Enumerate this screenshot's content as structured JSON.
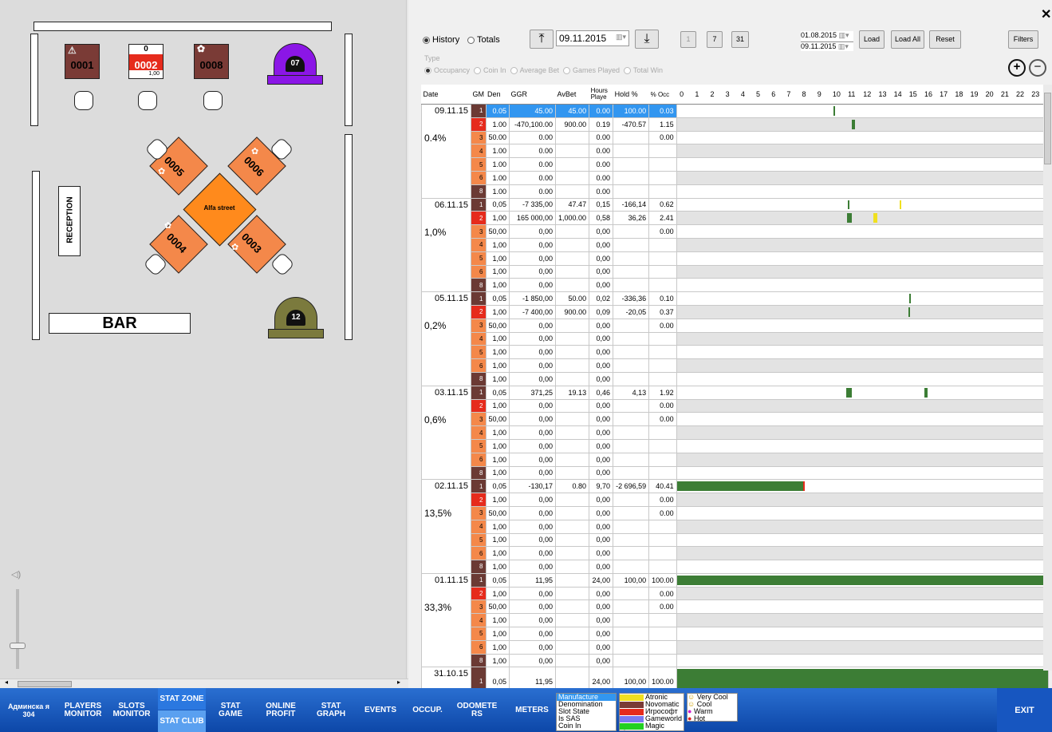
{
  "floor": {
    "machines": [
      {
        "id": "0001",
        "color": "#7a3b36",
        "warn": true
      },
      {
        "id": "0002",
        "color": "#e62b1c",
        "top": "0",
        "bottom": "1,00"
      },
      {
        "id": "0008",
        "color": "#7a3b36",
        "gear": true
      }
    ],
    "domes": [
      {
        "label": "07",
        "color": "#8b16e6"
      },
      {
        "label": "12",
        "color": "#7b7a3d"
      }
    ],
    "diamond_machines": [
      "0005",
      "0006",
      "0004",
      "0003"
    ],
    "center_label": "Alfa street",
    "reception": "RECEPTION",
    "bar": "BAR"
  },
  "controls": {
    "history": "History",
    "totals": "Totals",
    "date": "09.11.2015",
    "day_buttons": [
      "1",
      "7",
      "31"
    ],
    "range_from": "01.08.2015",
    "range_to": "09.11.2015",
    "load": "Load",
    "load_all": "Load All",
    "reset": "Reset",
    "filters": "Filters",
    "type_label": "Type",
    "type_options": [
      "Occupancy",
      "Coin In",
      "Average Bet",
      "Games Played",
      "Total Win"
    ]
  },
  "grid": {
    "headers": [
      "Date",
      "GM",
      "Den",
      "GGR",
      "AvBet",
      "Hours Playe",
      "Hold %",
      "% Occ"
    ],
    "hours": [
      "0",
      "1",
      "2",
      "3",
      "4",
      "5",
      "6",
      "7",
      "8",
      "9",
      "10",
      "11",
      "12",
      "13",
      "14",
      "15",
      "16",
      "17",
      "18",
      "19",
      "20",
      "21",
      "22",
      "23"
    ],
    "groups": [
      {
        "date": "09.11.15",
        "pct": "0.4%",
        "rows": [
          [
            "1",
            "0.05",
            "45.00",
            "45.00",
            "0.00",
            "100.00",
            "0.03"
          ],
          [
            "2",
            "1.00",
            "-470,100.00",
            "900.00",
            "0.19",
            "-470.57",
            "1.15"
          ],
          [
            "3",
            "50.00",
            "0.00",
            "",
            "0.00",
            "",
            "0.00"
          ],
          [
            "4",
            "1.00",
            "0.00",
            "",
            "0.00",
            "",
            ""
          ],
          [
            "5",
            "1.00",
            "0.00",
            "",
            "0.00",
            "",
            ""
          ],
          [
            "6",
            "1.00",
            "0.00",
            "",
            "0.00",
            "",
            ""
          ],
          [
            "8",
            "1.00",
            "0.00",
            "",
            "0.00",
            "",
            ""
          ]
        ]
      },
      {
        "date": "06.11.15",
        "pct": "1,0%",
        "rows": [
          [
            "1",
            "0,05",
            "-7 335,00",
            "47.47",
            "0,15",
            "-166,14",
            "0.62"
          ],
          [
            "2",
            "1,00",
            "165 000,00",
            "1,000.00",
            "0,58",
            "36,26",
            "2.41"
          ],
          [
            "3",
            "50,00",
            "0,00",
            "",
            "0,00",
            "",
            "0.00"
          ],
          [
            "4",
            "1,00",
            "0,00",
            "",
            "0,00",
            "",
            ""
          ],
          [
            "5",
            "1,00",
            "0,00",
            "",
            "0,00",
            "",
            ""
          ],
          [
            "6",
            "1,00",
            "0,00",
            "",
            "0,00",
            "",
            ""
          ],
          [
            "8",
            "1,00",
            "0,00",
            "",
            "0,00",
            "",
            ""
          ]
        ]
      },
      {
        "date": "05.11.15",
        "pct": "0,2%",
        "rows": [
          [
            "1",
            "0,05",
            "-1 850,00",
            "50.00",
            "0,02",
            "-336,36",
            "0.10"
          ],
          [
            "2",
            "1,00",
            "-7 400,00",
            "900.00",
            "0,09",
            "-20,05",
            "0.37"
          ],
          [
            "3",
            "50,00",
            "0,00",
            "",
            "0,00",
            "",
            "0.00"
          ],
          [
            "4",
            "1,00",
            "0,00",
            "",
            "0,00",
            "",
            ""
          ],
          [
            "5",
            "1,00",
            "0,00",
            "",
            "0,00",
            "",
            ""
          ],
          [
            "6",
            "1,00",
            "0,00",
            "",
            "0,00",
            "",
            ""
          ],
          [
            "8",
            "1,00",
            "0,00",
            "",
            "0,00",
            "",
            ""
          ]
        ]
      },
      {
        "date": "03.11.15",
        "pct": "0,6%",
        "rows": [
          [
            "1",
            "0,05",
            "371,25",
            "19.13",
            "0,46",
            "4,13",
            "1.92"
          ],
          [
            "2",
            "1,00",
            "0,00",
            "",
            "0,00",
            "",
            "0.00"
          ],
          [
            "3",
            "50,00",
            "0,00",
            "",
            "0,00",
            "",
            "0.00"
          ],
          [
            "4",
            "1,00",
            "0,00",
            "",
            "0,00",
            "",
            ""
          ],
          [
            "5",
            "1,00",
            "0,00",
            "",
            "0,00",
            "",
            ""
          ],
          [
            "6",
            "1,00",
            "0,00",
            "",
            "0,00",
            "",
            ""
          ],
          [
            "8",
            "1,00",
            "0,00",
            "",
            "0,00",
            "",
            ""
          ]
        ]
      },
      {
        "date": "02.11.15",
        "pct": "13,5%",
        "rows": [
          [
            "1",
            "0,05",
            "-130,17",
            "0.80",
            "9,70",
            "-2 696,59",
            "40.41"
          ],
          [
            "2",
            "1,00",
            "0,00",
            "",
            "0,00",
            "",
            "0.00"
          ],
          [
            "3",
            "50,00",
            "0,00",
            "",
            "0,00",
            "",
            "0.00"
          ],
          [
            "4",
            "1,00",
            "0,00",
            "",
            "0,00",
            "",
            ""
          ],
          [
            "5",
            "1,00",
            "0,00",
            "",
            "0,00",
            "",
            ""
          ],
          [
            "6",
            "1,00",
            "0,00",
            "",
            "0,00",
            "",
            ""
          ],
          [
            "8",
            "1,00",
            "0,00",
            "",
            "0,00",
            "",
            ""
          ]
        ]
      },
      {
        "date": "01.11.15",
        "pct": "33,3%",
        "rows": [
          [
            "1",
            "0,05",
            "11,95",
            "",
            "24,00",
            "100,00",
            "100.00"
          ],
          [
            "2",
            "1,00",
            "0,00",
            "",
            "0,00",
            "",
            "0.00"
          ],
          [
            "3",
            "50,00",
            "0,00",
            "",
            "0,00",
            "",
            "0.00"
          ],
          [
            "4",
            "1,00",
            "0,00",
            "",
            "0,00",
            "",
            ""
          ],
          [
            "5",
            "1,00",
            "0,00",
            "",
            "0,00",
            "",
            ""
          ],
          [
            "6",
            "1,00",
            "0,00",
            "",
            "0,00",
            "",
            ""
          ],
          [
            "8",
            "1,00",
            "0,00",
            "",
            "0,00",
            "",
            ""
          ]
        ]
      },
      {
        "date": "31.10.15",
        "pct": "",
        "rows": [
          [
            "1",
            "0,05",
            "11,95",
            "",
            "24,00",
            "100,00",
            "100.00"
          ]
        ]
      }
    ],
    "activity": [
      {
        "g": 0,
        "r": 0,
        "start": 10.1,
        "end": 10.15,
        "color": "#3c7d35"
      },
      {
        "g": 0,
        "r": 1,
        "start": 11.3,
        "end": 11.5,
        "color": "#3c7d35"
      },
      {
        "g": 1,
        "r": 0,
        "start": 11.05,
        "end": 11.1,
        "color": "#3c7d35"
      },
      {
        "g": 1,
        "r": 0,
        "start": 14.4,
        "end": 14.45,
        "color": "#f0e020"
      },
      {
        "g": 1,
        "r": 1,
        "start": 11.0,
        "end": 11.3,
        "color": "#3c7d35"
      },
      {
        "g": 1,
        "r": 1,
        "start": 12.7,
        "end": 12.95,
        "color": "#f0e020"
      },
      {
        "g": 2,
        "r": 0,
        "start": 15.0,
        "end": 15.05,
        "color": "#3c7d35"
      },
      {
        "g": 2,
        "r": 1,
        "start": 14.95,
        "end": 15.0,
        "color": "#3c7d35"
      },
      {
        "g": 3,
        "r": 0,
        "start": 10.95,
        "end": 11.3,
        "color": "#3c7d35"
      },
      {
        "g": 3,
        "r": 0,
        "start": 16.0,
        "end": 16.2,
        "color": "#3c7d35"
      },
      {
        "g": 4,
        "r": 0,
        "start": 0.0,
        "end": 8.2,
        "color": "#3c7d35"
      },
      {
        "g": 4,
        "r": 0,
        "start": 8.15,
        "end": 8.25,
        "color": "#e62b1c"
      },
      {
        "g": 5,
        "r": 0,
        "start": 0.0,
        "end": 24.0,
        "color": "#3c7d35"
      },
      {
        "g": 6,
        "r": 0,
        "start": 0.0,
        "end": 24.0,
        "color": "#3c7d35"
      }
    ]
  },
  "taskbar": {
    "items": [
      "Админска я 304",
      "PLAYERS MONITOR",
      "SLOTS MONITOR",
      "STAT ZONE",
      "STAT CLUB",
      "STAT GAME",
      "ONLINE PROFIT",
      "STAT GRAPH",
      "EVENTS",
      "OCCUP.",
      "ODOMETE RS",
      "METERS"
    ],
    "list1": [
      "Manufacture",
      "Denomination",
      "Slot State",
      "Is SAS",
      "Coin In"
    ],
    "list2": [
      {
        "name": "Atronic",
        "color": "#f0e020"
      },
      {
        "name": "Novomatic",
        "color": "#7a3b36"
      },
      {
        "name": "Игрософт",
        "color": "#e62b1c"
      },
      {
        "name": "Gameworld",
        "color": "#7b7af0"
      },
      {
        "name": "Magic place",
        "color": "#22d022"
      }
    ],
    "list3": [
      {
        "name": "Very Cool",
        "icon": "☺"
      },
      {
        "name": "Cool",
        "icon": "☺"
      },
      {
        "name": "Warm",
        "icon": "●",
        "color": "#d020d0"
      },
      {
        "name": "Hot",
        "icon": "●",
        "color": "#e02020"
      }
    ],
    "exit": "EXIT"
  }
}
